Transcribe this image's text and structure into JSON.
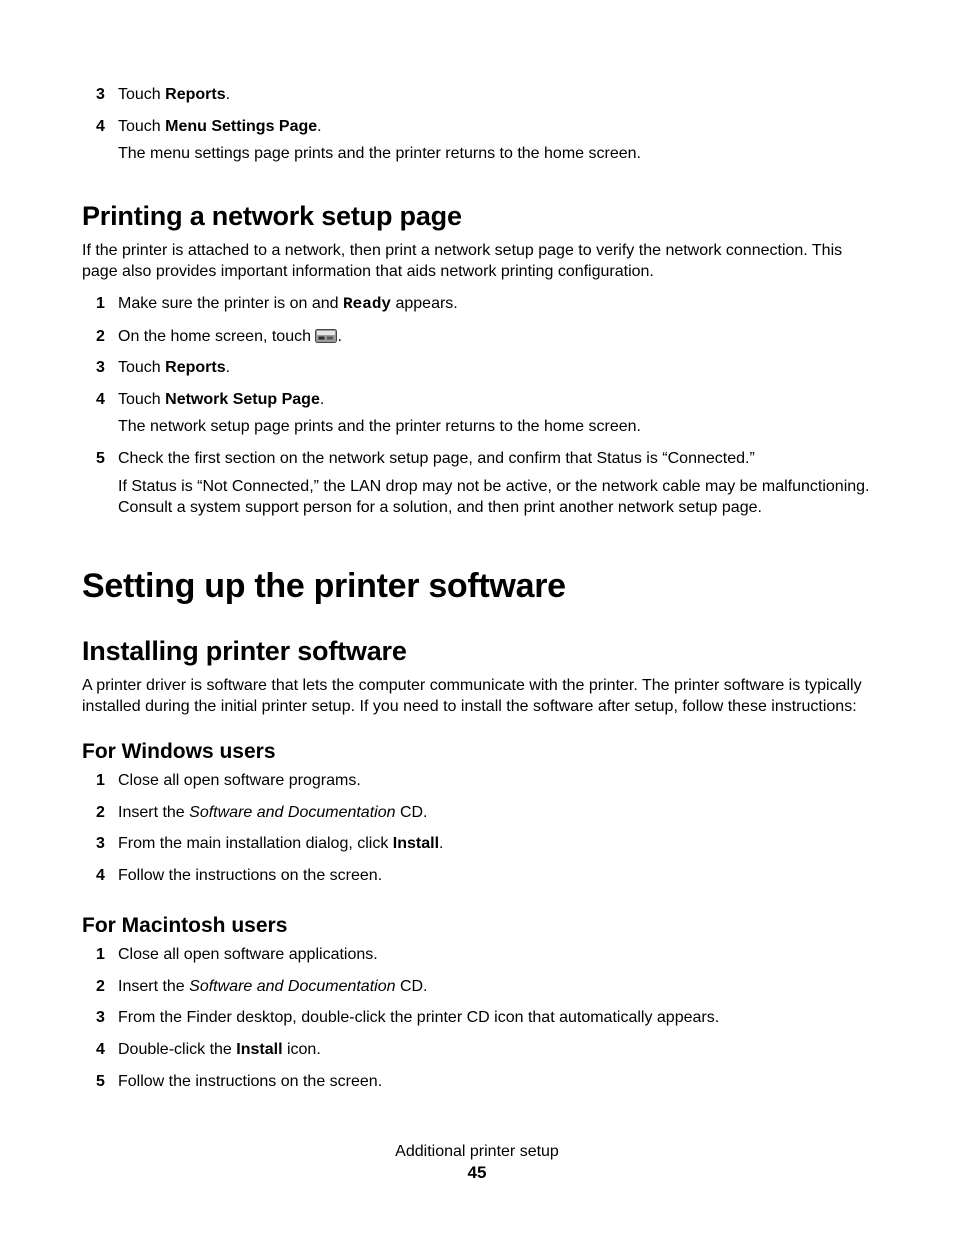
{
  "top_list": [
    {
      "num": "3",
      "lines": [
        {
          "segments": [
            {
              "t": "Touch "
            },
            {
              "t": "Reports",
              "b": true
            },
            {
              "t": "."
            }
          ]
        }
      ]
    },
    {
      "num": "4",
      "lines": [
        {
          "segments": [
            {
              "t": "Touch "
            },
            {
              "t": "Menu Settings Page",
              "b": true
            },
            {
              "t": "."
            }
          ]
        },
        {
          "segments": [
            {
              "t": "The menu settings page prints and the printer returns to the home screen."
            }
          ]
        }
      ]
    }
  ],
  "sec_network": {
    "heading": "Printing a network setup page",
    "intro": "If the printer is attached to a network, then print a network setup page to verify the network connection. This page also provides important information that aids network printing configuration.",
    "items": [
      {
        "num": "1",
        "lines": [
          {
            "segments": [
              {
                "t": "Make sure the printer is on and "
              },
              {
                "t": "Ready",
                "mono": true
              },
              {
                "t": " appears."
              }
            ]
          }
        ]
      },
      {
        "num": "2",
        "lines": [
          {
            "segments": [
              {
                "t": "On the home screen, touch "
              },
              {
                "icon": "menu-button-icon"
              },
              {
                "t": "."
              }
            ]
          }
        ]
      },
      {
        "num": "3",
        "lines": [
          {
            "segments": [
              {
                "t": "Touch "
              },
              {
                "t": "Reports",
                "b": true
              },
              {
                "t": "."
              }
            ]
          }
        ]
      },
      {
        "num": "4",
        "lines": [
          {
            "segments": [
              {
                "t": "Touch "
              },
              {
                "t": "Network Setup Page",
                "b": true
              },
              {
                "t": "."
              }
            ]
          },
          {
            "segments": [
              {
                "t": "The network setup page prints and the printer returns to the home screen."
              }
            ]
          }
        ]
      },
      {
        "num": "5",
        "lines": [
          {
            "segments": [
              {
                "t": "Check the first section on the network setup page, and confirm that Status is “Connected.”"
              }
            ]
          },
          {
            "segments": [
              {
                "t": "If Status is “Not Connected,” the LAN drop may not be active, or the network cable may be malfunctioning. Consult a system support person for a solution, and then print another network setup page."
              }
            ]
          }
        ]
      }
    ]
  },
  "sec_setup": {
    "heading": "Setting up the printer software",
    "sub_install": {
      "heading": "Installing printer software",
      "intro": "A printer driver is software that lets the computer communicate with the printer. The printer software is typically installed during the initial printer setup. If you need to install the software after setup, follow these instructions:",
      "windows": {
        "heading": "For Windows users",
        "items": [
          {
            "num": "1",
            "lines": [
              {
                "segments": [
                  {
                    "t": "Close all open software programs."
                  }
                ]
              }
            ]
          },
          {
            "num": "2",
            "lines": [
              {
                "segments": [
                  {
                    "t": "Insert the "
                  },
                  {
                    "t": "Software and Documentation",
                    "i": true
                  },
                  {
                    "t": " CD."
                  }
                ]
              }
            ]
          },
          {
            "num": "3",
            "lines": [
              {
                "segments": [
                  {
                    "t": "From the main installation dialog, click "
                  },
                  {
                    "t": "Install",
                    "b": true
                  },
                  {
                    "t": "."
                  }
                ]
              }
            ]
          },
          {
            "num": "4",
            "lines": [
              {
                "segments": [
                  {
                    "t": "Follow the instructions on the screen."
                  }
                ]
              }
            ]
          }
        ]
      },
      "mac": {
        "heading": "For Macintosh users",
        "items": [
          {
            "num": "1",
            "lines": [
              {
                "segments": [
                  {
                    "t": "Close all open software applications."
                  }
                ]
              }
            ]
          },
          {
            "num": "2",
            "lines": [
              {
                "segments": [
                  {
                    "t": "Insert the "
                  },
                  {
                    "t": "Software and Documentation",
                    "i": true
                  },
                  {
                    "t": " CD."
                  }
                ]
              }
            ]
          },
          {
            "num": "3",
            "lines": [
              {
                "segments": [
                  {
                    "t": "From the Finder desktop, double-click the printer CD icon that automatically appears."
                  }
                ]
              }
            ]
          },
          {
            "num": "4",
            "lines": [
              {
                "segments": [
                  {
                    "t": "Double-click the "
                  },
                  {
                    "t": "Install",
                    "b": true
                  },
                  {
                    "t": " icon."
                  }
                ]
              }
            ]
          },
          {
            "num": "5",
            "lines": [
              {
                "segments": [
                  {
                    "t": "Follow the instructions on the screen."
                  }
                ]
              }
            ]
          }
        ]
      }
    }
  },
  "footer": {
    "title": "Additional printer setup",
    "page": "45"
  }
}
